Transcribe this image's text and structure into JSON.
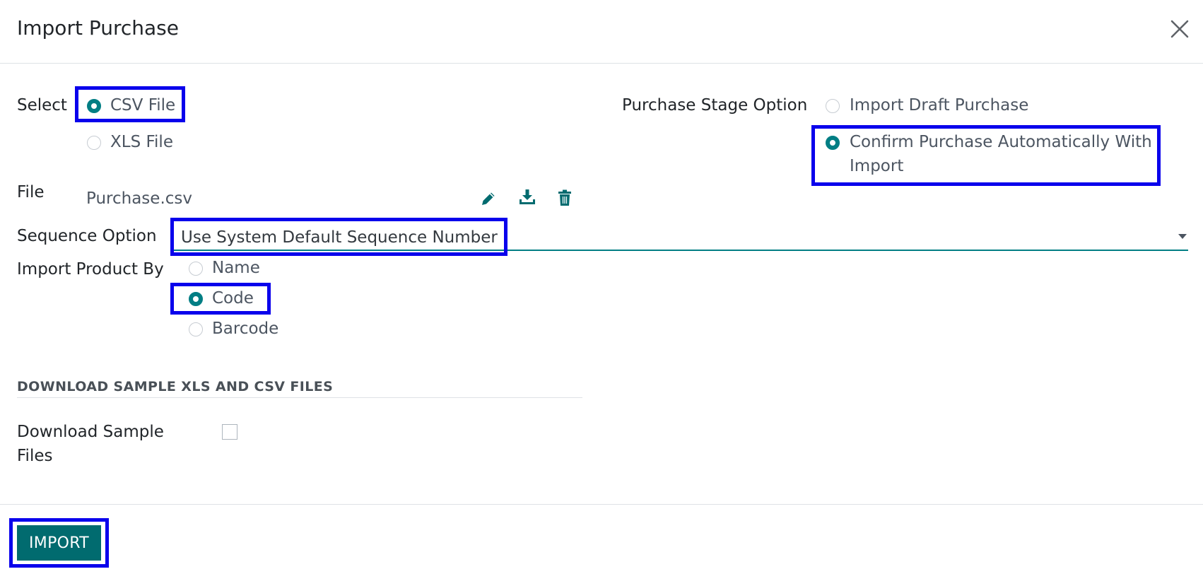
{
  "dialog": {
    "title": "Import Purchase"
  },
  "form": {
    "select_label": "Select",
    "file_types": [
      {
        "label": "CSV File",
        "checked": true
      },
      {
        "label": "XLS File",
        "checked": false
      }
    ],
    "stage_label": "Purchase Stage Option",
    "stage_options": [
      {
        "label": "Import Draft Purchase",
        "checked": false
      },
      {
        "label_line1": "Confirm Purchase Automatically With",
        "label_line2": "Import",
        "checked": true
      }
    ],
    "file_label": "File",
    "file_name": "Purchase.csv",
    "sequence_label": "Sequence Option",
    "sequence_value": "Use System Default Sequence Number",
    "product_by_label": "Import Product By",
    "product_by_options": [
      {
        "label": "Name",
        "checked": false
      },
      {
        "label": "Code",
        "checked": true
      },
      {
        "label": "Barcode",
        "checked": false
      }
    ]
  },
  "samples": {
    "section_title": "DOWNLOAD SAMPLE XLS AND CSV FILES",
    "label_line1": "Download Sample",
    "label_line2": "Files",
    "checked": false
  },
  "footer": {
    "import_label": "IMPORT"
  },
  "icons": {
    "close": "close-icon",
    "edit": "pencil-icon",
    "download": "download-icon",
    "delete": "trash-icon"
  },
  "colors": {
    "accent": "#017e84",
    "button": "#016b6f",
    "highlight": "#0a00ec"
  }
}
